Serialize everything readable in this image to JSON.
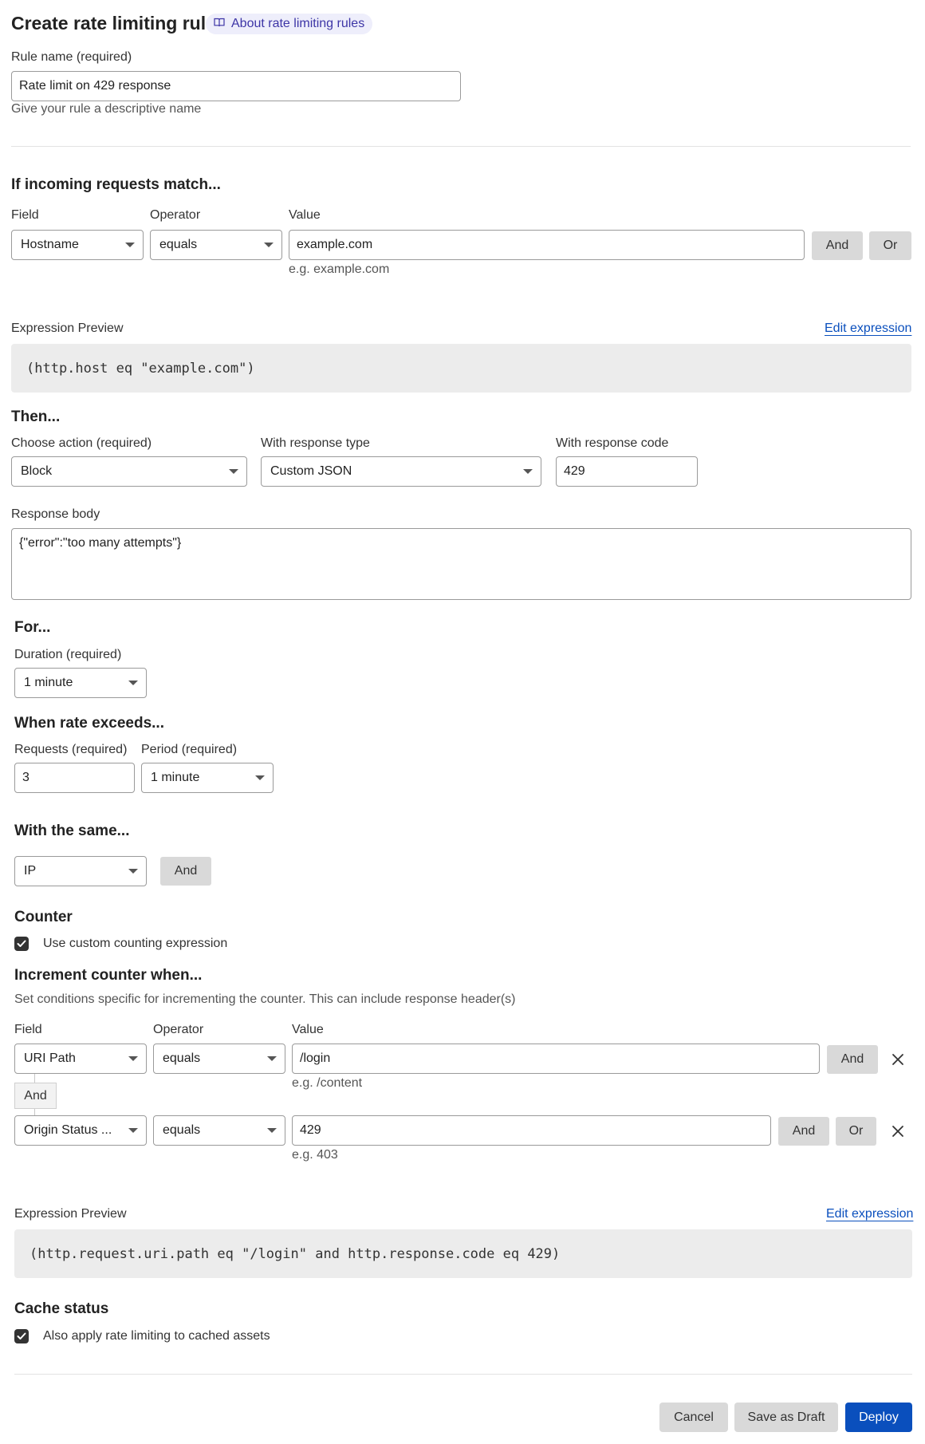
{
  "header": {
    "title": "Create rate limiting rule",
    "about_link": "About rate limiting rules",
    "about_icon": "book-icon"
  },
  "rule_name": {
    "label": "Rule name (required)",
    "value": "Rate limit on 429 response",
    "help": "Give your rule a descriptive name"
  },
  "match": {
    "heading": "If incoming requests match...",
    "field_label": "Field",
    "operator_label": "Operator",
    "value_label": "Value",
    "field_value": "Hostname",
    "operator_value": "equals",
    "value": "example.com",
    "value_hint": "e.g. example.com",
    "and_label": "And",
    "or_label": "Or"
  },
  "preview1": {
    "label": "Expression Preview",
    "edit_link": "Edit expression",
    "expression": "(http.host eq \"example.com\")"
  },
  "then": {
    "heading": "Then...",
    "action_label": "Choose action (required)",
    "action_value": "Block",
    "response_type_label": "With response type",
    "response_type_value": "Custom JSON",
    "response_code_label": "With response code",
    "response_code_value": "429",
    "body_label": "Response body",
    "body_value": "{\"error\":\"too many attempts\"}"
  },
  "for": {
    "heading": "For...",
    "duration_label": "Duration (required)",
    "duration_value": "1 minute"
  },
  "rate": {
    "heading": "When rate exceeds...",
    "requests_label": "Requests (required)",
    "requests_value": "3",
    "period_label": "Period (required)",
    "period_value": "1 minute"
  },
  "same": {
    "heading": "With the same...",
    "value": "IP",
    "and_label": "And"
  },
  "counter": {
    "heading": "Counter",
    "checkbox_label": "Use custom counting expression",
    "checked": true
  },
  "increment": {
    "heading": "Increment counter when...",
    "description": "Set conditions specific for incrementing the counter. This can include response header(s)",
    "field_label": "Field",
    "operator_label": "Operator",
    "value_label": "Value",
    "rows": [
      {
        "field": "URI Path",
        "operator": "equals",
        "value": "/login",
        "hint": "e.g. /content"
      },
      {
        "field": "Origin Status ...",
        "operator": "equals",
        "value": "429",
        "hint": "e.g. 403"
      }
    ],
    "connector_label": "And",
    "and_label": "And",
    "or_label": "Or"
  },
  "preview2": {
    "label": "Expression Preview",
    "edit_link": "Edit expression",
    "expression": "(http.request.uri.path eq \"/login\" and http.response.code eq 429)"
  },
  "cache": {
    "heading": "Cache status",
    "checkbox_label": "Also apply rate limiting to cached assets",
    "checked": true
  },
  "footer": {
    "cancel": "Cancel",
    "save_draft": "Save as Draft",
    "deploy": "Deploy"
  },
  "colors": {
    "primary": "#0a4fbd",
    "link": "#0a4fbd",
    "pill_bg": "#eeeefb",
    "pill_text": "#3d35a6"
  }
}
